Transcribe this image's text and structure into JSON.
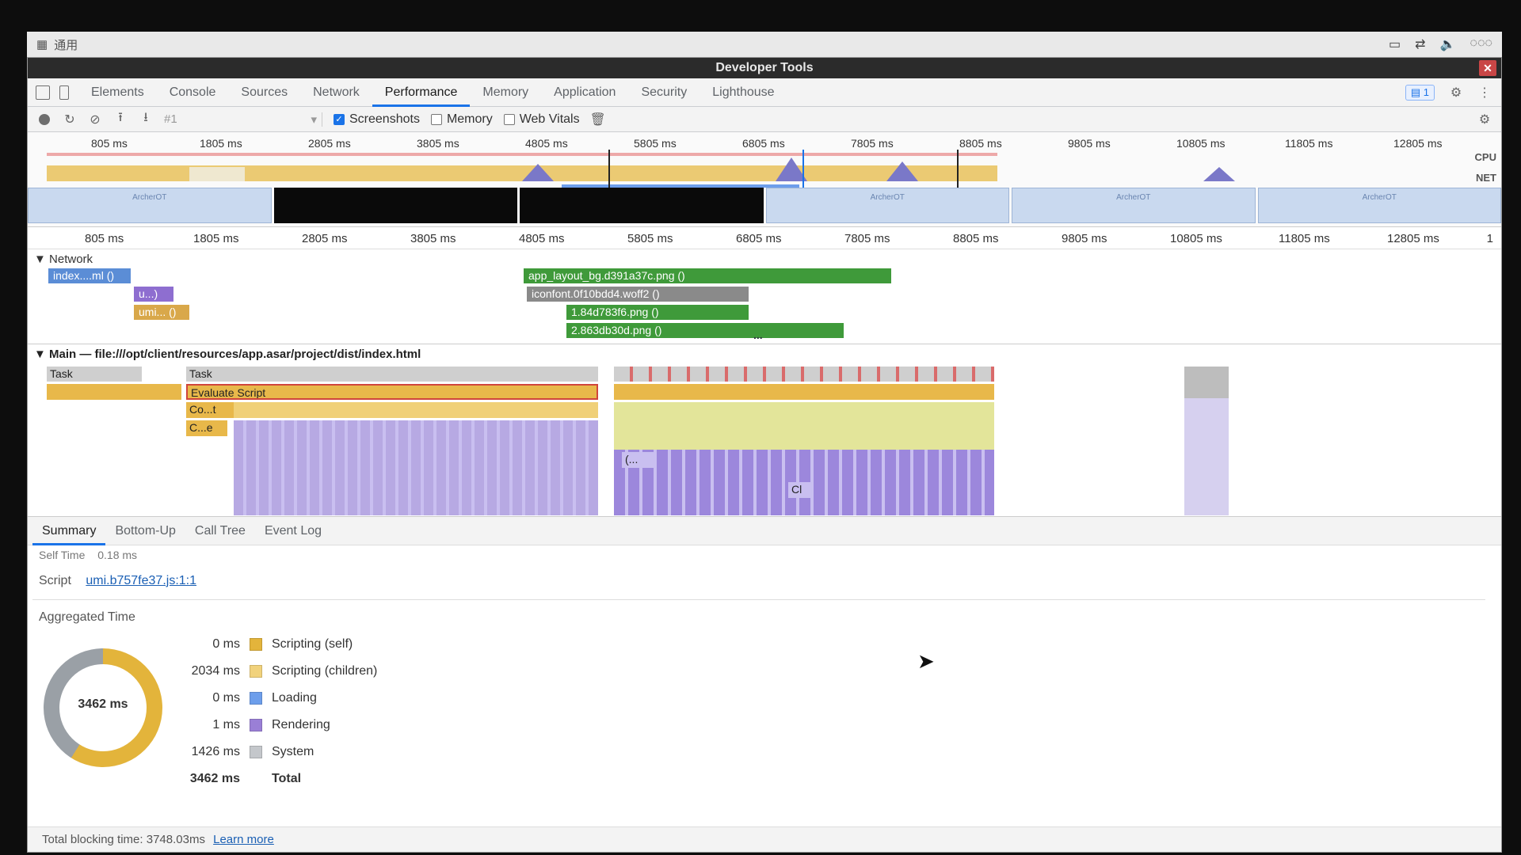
{
  "taskbar": {
    "start_label": "通用"
  },
  "window": {
    "title": "Developer Tools"
  },
  "tabs": [
    "Elements",
    "Console",
    "Sources",
    "Network",
    "Performance",
    "Memory",
    "Application",
    "Security",
    "Lighthouse"
  ],
  "active_tab": "Performance",
  "issues_badge": "1",
  "toolbar": {
    "profile_select": "#1",
    "screenshots_label": "Screenshots",
    "screenshots_checked": true,
    "memory_label": "Memory",
    "memory_checked": false,
    "webvitals_label": "Web Vitals",
    "webvitals_checked": false
  },
  "overview": {
    "ticks": [
      "805 ms",
      "1805 ms",
      "2805 ms",
      "3805 ms",
      "4805 ms",
      "5805 ms",
      "6805 ms",
      "7805 ms",
      "8805 ms",
      "9805 ms",
      "10805 ms",
      "11805 ms",
      "12805 ms"
    ],
    "lane_cpu": "CPU",
    "lane_net": "NET",
    "screenshot_label": "ArcherOT"
  },
  "main_ruler": {
    "ticks": [
      "805 ms",
      "1805 ms",
      "2805 ms",
      "3805 ms",
      "4805 ms",
      "5805 ms",
      "6805 ms",
      "7805 ms",
      "8805 ms",
      "9805 ms",
      "10805 ms",
      "11805 ms",
      "12805 ms"
    ],
    "end_mark": "1"
  },
  "network": {
    "header": "Network",
    "requests": [
      "index....ml ()",
      "u...)",
      "umi... ()",
      "app_layout_bg.d391a37c.png ()",
      "iconfont.0f10bdd4.woff2 ()",
      "1.84d783f6.png ()",
      "2.863db30d.png ()"
    ],
    "more": "..."
  },
  "main": {
    "header": "Main — file:///opt/client/resources/app.asar/project/dist/index.html",
    "task_labels": [
      "Task",
      "Task"
    ],
    "evaluate_script": "Evaluate Script",
    "co_label": "Co...t",
    "ce_label": "C...e",
    "paren_label": "(...",
    "ci_label": "Cl"
  },
  "bottom_tabs": [
    "Summary",
    "Bottom-Up",
    "Call Tree",
    "Event Log"
  ],
  "active_bottom_tab": "Summary",
  "summary": {
    "self_time_label": "Self Time",
    "self_time_value": "0.18 ms",
    "script_label": "Script",
    "script_link": "umi.b757fe37.js:1:1",
    "aggregated_title": "Aggregated Time",
    "donut_total": "3462 ms",
    "rows": [
      {
        "value": "0 ms",
        "name": "Scripting (self)",
        "color": "#e3b43b"
      },
      {
        "value": "2034 ms",
        "name": "Scripting (children)",
        "color": "#f1d27c"
      },
      {
        "value": "0 ms",
        "name": "Loading",
        "color": "#6d9eeb"
      },
      {
        "value": "1 ms",
        "name": "Rendering",
        "color": "#9a7fd6"
      },
      {
        "value": "1426 ms",
        "name": "System",
        "color": "#c4c7cb"
      },
      {
        "value": "3462 ms",
        "name": "Total",
        "color": ""
      }
    ]
  },
  "footer": {
    "text": "Total blocking time: 3748.03ms",
    "link": "Learn more"
  }
}
